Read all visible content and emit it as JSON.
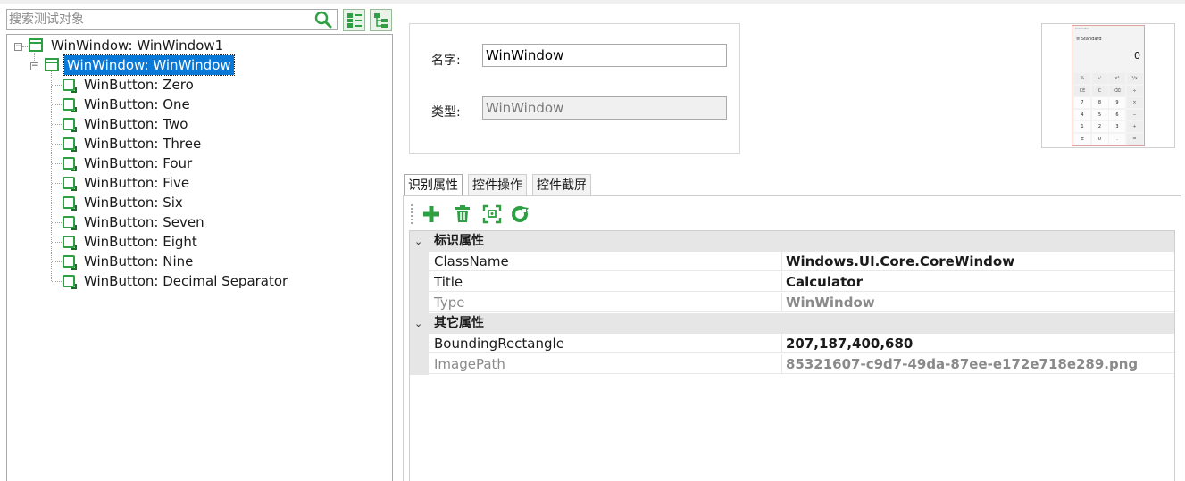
{
  "search": {
    "placeholder": "搜索测试对象"
  },
  "tree": {
    "root": {
      "label": "WinWindow: WinWindow1"
    },
    "child": {
      "label": "WinWindow: WinWindow"
    },
    "buttons": [
      "WinButton: Zero",
      "WinButton: One",
      "WinButton: Two",
      "WinButton: Three",
      "WinButton: Four",
      "WinButton: Five",
      "WinButton: Six",
      "WinButton: Seven",
      "WinButton: Eight",
      "WinButton: Nine",
      "WinButton: Decimal Separator"
    ]
  },
  "info": {
    "name_label": "名字:",
    "name_value": "WinWindow",
    "type_label": "类型:",
    "type_value": "WinWindow"
  },
  "preview": {
    "title": "Calculator",
    "mode": "Standard",
    "display": "0",
    "keys": [
      "%",
      "√",
      "x²",
      "¹/x",
      "CE",
      "C",
      "⌫",
      "÷",
      "7",
      "8",
      "9",
      "×",
      "4",
      "5",
      "6",
      "−",
      "1",
      "2",
      "3",
      "+",
      "±",
      "0",
      ".",
      "="
    ]
  },
  "tabs": [
    "识别属性",
    "控件操作",
    "控件截屏"
  ],
  "properties": {
    "categories": [
      {
        "name": "标识属性",
        "rows": [
          {
            "name": "ClassName",
            "value": "Windows.UI.Core.CoreWindow"
          },
          {
            "name": "Title",
            "value": "Calculator"
          },
          {
            "name": "Type",
            "value": "WinWindow"
          }
        ]
      },
      {
        "name": "其它属性",
        "rows": [
          {
            "name": "BoundingRectangle",
            "value": "207,187,400,680"
          },
          {
            "name": "ImagePath",
            "value": "85321607-c9d7-49da-87ee-e172e718e289.png"
          }
        ]
      }
    ]
  },
  "colors": {
    "accent": "#0a78d7",
    "icon_green": "#2ea043"
  }
}
